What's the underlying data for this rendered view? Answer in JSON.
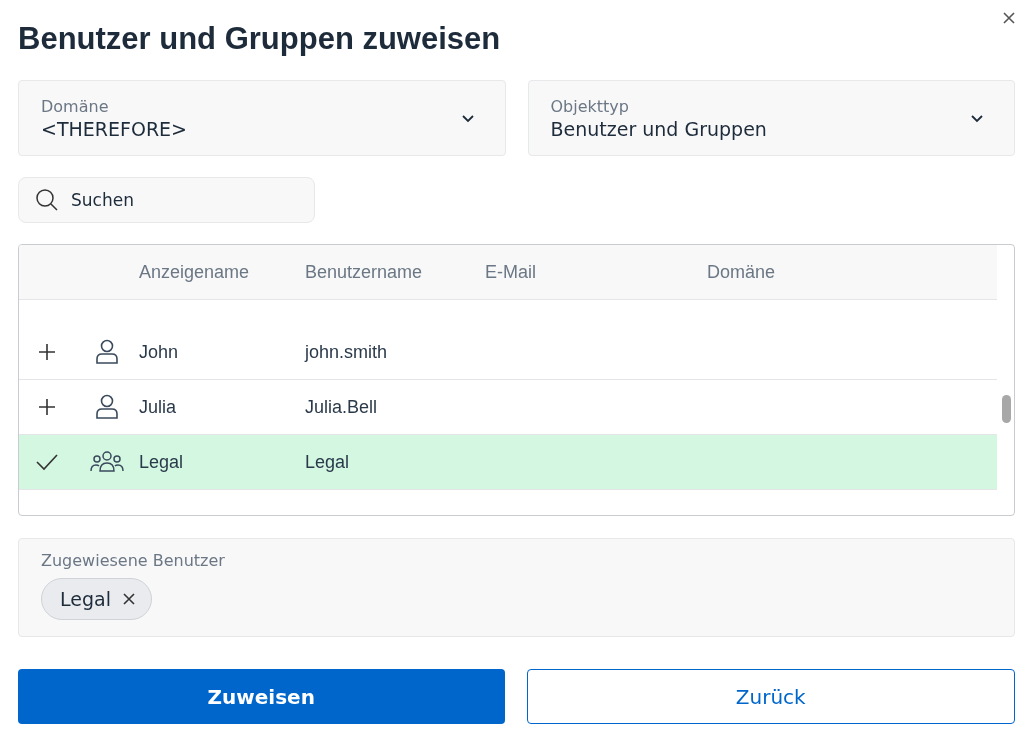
{
  "dialog": {
    "title": "Benutzer und Gruppen zuweisen"
  },
  "filters": [
    {
      "label": "Domäne",
      "value": "<THEREFORE>"
    },
    {
      "label": "Objekttyp",
      "value": "Benutzer und Gruppen"
    }
  ],
  "search": {
    "placeholder": "Suchen"
  },
  "table": {
    "columns": [
      "Anzeigename",
      "Benutzername",
      "E-Mail",
      "Domäne"
    ],
    "rows": [
      {
        "kind": "user",
        "selected": false,
        "cells": [
          "John",
          "john.smith",
          "",
          ""
        ]
      },
      {
        "kind": "user",
        "selected": false,
        "cells": [
          "Julia",
          "Julia.Bell",
          "",
          ""
        ]
      },
      {
        "kind": "group",
        "selected": true,
        "cells": [
          "Legal",
          "Legal",
          "",
          ""
        ]
      }
    ]
  },
  "assigned": {
    "label": "Zugewiesene Benutzer",
    "chips": [
      "Legal"
    ]
  },
  "buttons": [
    {
      "label": "Zuweisen",
      "kind": "primary"
    },
    {
      "label": "Zurück",
      "kind": "secondary"
    }
  ]
}
